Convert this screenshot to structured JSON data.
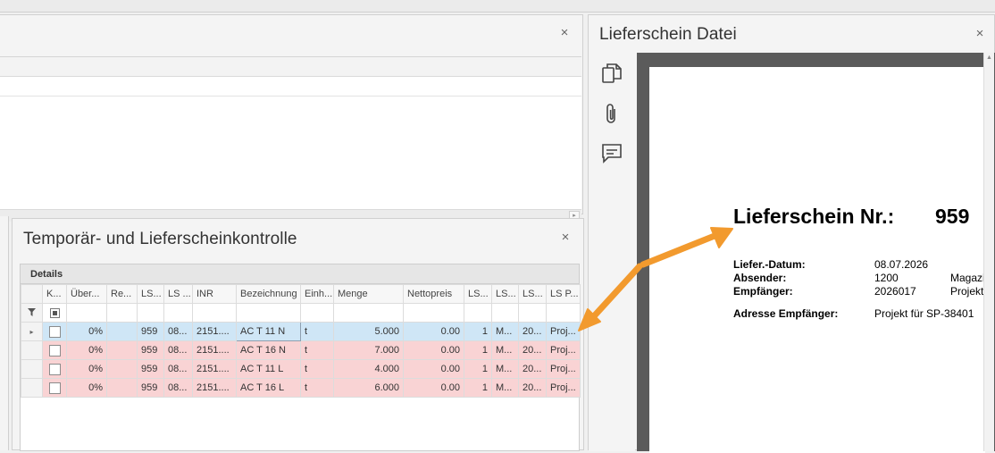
{
  "top_panel": {
    "close_label": "×"
  },
  "temp_panel": {
    "title": "Temporär- und Lieferscheinkontrolle",
    "close_label": "×",
    "details_label": "Details",
    "columns": [
      "K...",
      "Über...",
      "Re...",
      "LS...",
      "LS ...",
      "INR",
      "Bezeichnung",
      "Einh...",
      "Menge",
      "Nettopreis",
      "LS...",
      "LS...",
      "LS...",
      "LS P..."
    ],
    "rows": [
      {
        "pct": "0%",
        "ls": "959",
        "date": "08...",
        "inr": "2151....",
        "bez": "AC T 11 N",
        "einh": "t",
        "menge": "5.000",
        "preis": "0.00",
        "c1": "1",
        "c2": "M...",
        "c3": "20...",
        "c4": "Proj..."
      },
      {
        "pct": "0%",
        "ls": "959",
        "date": "08...",
        "inr": "2151....",
        "bez": "AC T 16 N",
        "einh": "t",
        "menge": "7.000",
        "preis": "0.00",
        "c1": "1",
        "c2": "M...",
        "c3": "20...",
        "c4": "Proj..."
      },
      {
        "pct": "0%",
        "ls": "959",
        "date": "08...",
        "inr": "2151....",
        "bez": "AC T 11 L",
        "einh": "t",
        "menge": "4.000",
        "preis": "0.00",
        "c1": "1",
        "c2": "M...",
        "c3": "20...",
        "c4": "Proj..."
      },
      {
        "pct": "0%",
        "ls": "959",
        "date": "08...",
        "inr": "2151....",
        "bez": "AC T 16 L",
        "einh": "t",
        "menge": "6.000",
        "preis": "0.00",
        "c1": "1",
        "c2": "M...",
        "c3": "20...",
        "c4": "Proj..."
      }
    ]
  },
  "right_panel": {
    "title": "Lieferschein Datei",
    "close_label": "×",
    "tools": [
      "copy-icon",
      "paperclip-icon",
      "comment-icon"
    ],
    "document": {
      "title": "Lieferschein Nr.:",
      "number": "959",
      "fields": [
        {
          "label": "Liefer.-Datum:",
          "value": "08.07.2026",
          "extra": ""
        },
        {
          "label": "Absender:",
          "value": "1200",
          "extra": "Magazi"
        },
        {
          "label": "Empfänger:",
          "value": "2026017",
          "extra": "Projekt"
        },
        {
          "label": "Adresse Empfänger:",
          "value": "Projekt für SP-38401",
          "extra": ""
        }
      ]
    }
  },
  "annotation": {
    "arrow_color": "#f29a2e"
  }
}
